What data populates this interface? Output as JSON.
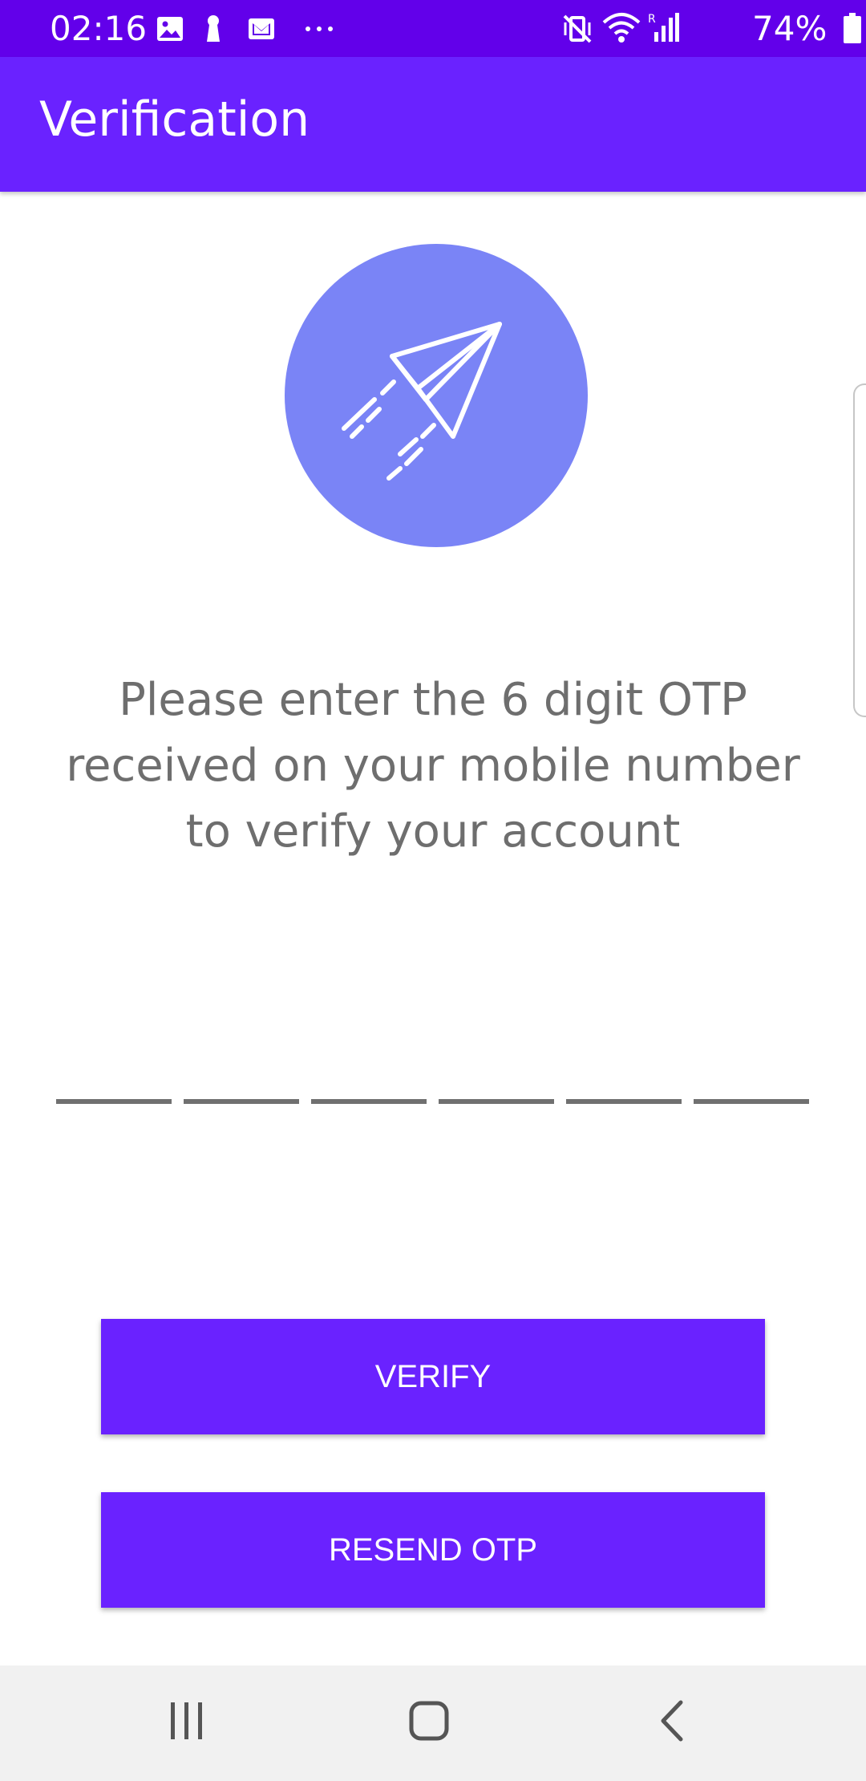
{
  "status_bar": {
    "time": "02:16",
    "battery": "74%",
    "left_icons": [
      "image-icon",
      "keyhole-icon",
      "mail-icon",
      "more-icon"
    ],
    "right_icons": [
      "vibrate-mute-icon",
      "wifi-icon",
      "signal-icon",
      "battery-icon"
    ]
  },
  "app_bar": {
    "title": "Verification"
  },
  "hero": {
    "icon": "paper-plane-icon",
    "circle_color": "#7a84f6"
  },
  "instruction": {
    "lines": [
      "Please enter the 6 digit OTP",
      "received on your mobile number",
      "to verify your account"
    ]
  },
  "otp": {
    "digits": [
      "",
      "",
      "",
      "",
      "",
      ""
    ]
  },
  "buttons": {
    "verify": "VERIFY",
    "resend": "RESEND OTP"
  },
  "nav_bar": {
    "icons": [
      "recent-apps-icon",
      "home-icon",
      "back-icon"
    ]
  },
  "colors": {
    "status_bar": "#6200ea",
    "primary": "#6a22ff",
    "text_secondary": "#6e6e6e",
    "nav_background": "#f1f1f1"
  }
}
